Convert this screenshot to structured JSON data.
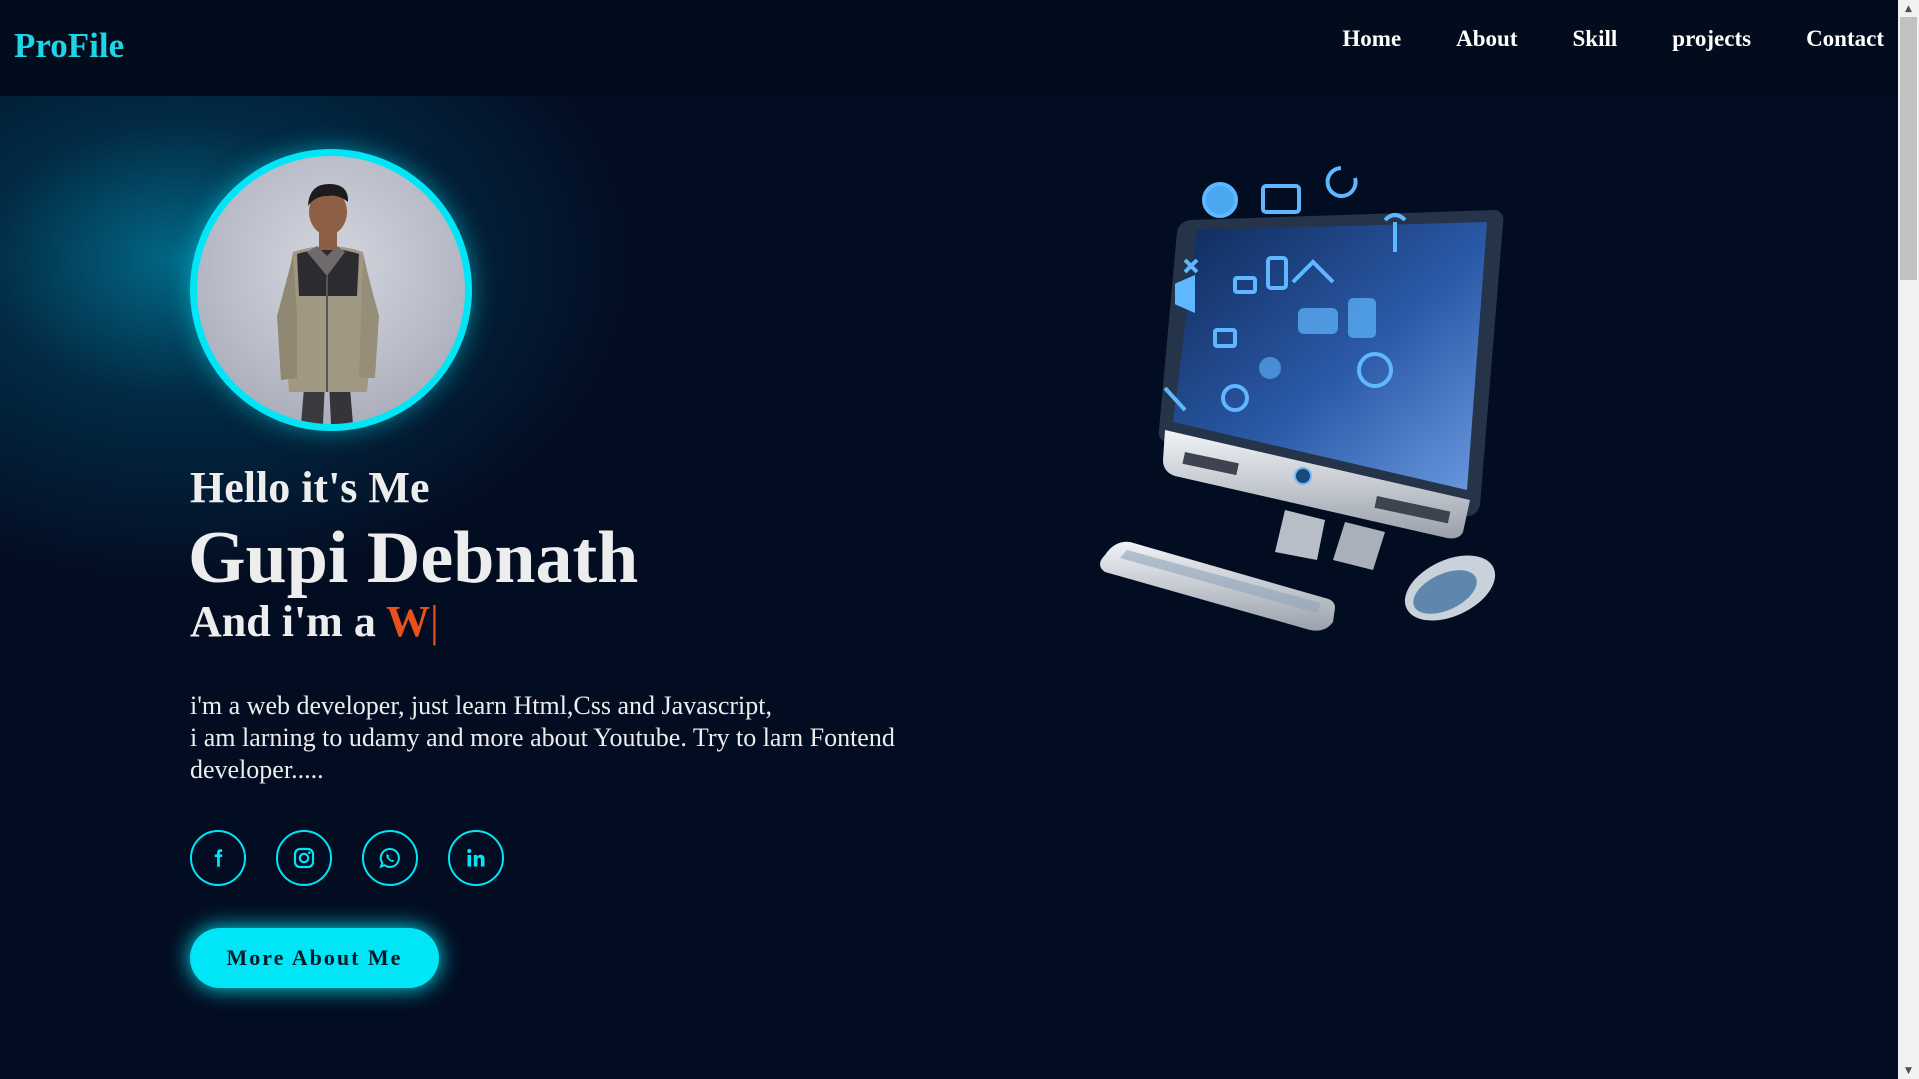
{
  "header": {
    "logo": "ProFile",
    "nav": [
      "Home",
      "About",
      "Skill",
      "projects",
      "Contact"
    ]
  },
  "hero": {
    "greeting": "Hello it's Me",
    "name": "Gupi Debnath",
    "role_prefix": "And i'm a ",
    "role_typed": "W",
    "cursor": "|",
    "description_lines": [
      "i'm a web developer, just learn Html,Css and Javascript,",
      "i am larning to udamy and more about Youtube. Try to larn Fontend developer....."
    ],
    "socials": [
      "facebook-icon",
      "instagram-icon",
      "whatsapp-icon",
      "linkedin-icon"
    ],
    "button_label": "More About Me"
  },
  "colors": {
    "background": "#030d22",
    "accent": "#00e6f6",
    "logo": "#1ed5e8",
    "typed_text": "#e8501c"
  },
  "scrollbar": {
    "up": "▲",
    "down": "▼"
  }
}
